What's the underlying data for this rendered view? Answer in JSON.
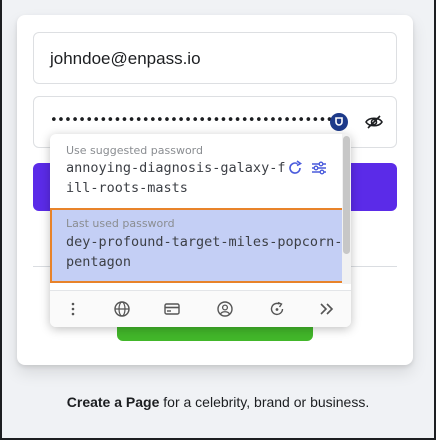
{
  "login": {
    "email_value": "johndoe@enpass.io",
    "password_value": "••••••••••••••••••••••••••••••••••••••••••"
  },
  "popup": {
    "suggested_label": "Use suggested password",
    "suggested_password": "annoying-diagnosis-galaxy-fill-roots-masts",
    "last_used_label": "Last used password",
    "last_used_password": "dey-profound-target-miles-popcorn-pentagon"
  },
  "footer": {
    "create_page_link": "Create a Page",
    "rest_text": " for a celebrity, brand or business."
  },
  "colors": {
    "login_button": "#5b2be8",
    "create_button": "#42b72a",
    "highlight_bg": "#c4cff5",
    "highlight_border": "#e8832a"
  },
  "icons": [
    "enpass-icon",
    "hide-password-icon",
    "refresh-icon",
    "options-icon",
    "more-icon",
    "globe-icon",
    "card-icon",
    "identity-icon",
    "generator-icon",
    "expand-icon"
  ]
}
